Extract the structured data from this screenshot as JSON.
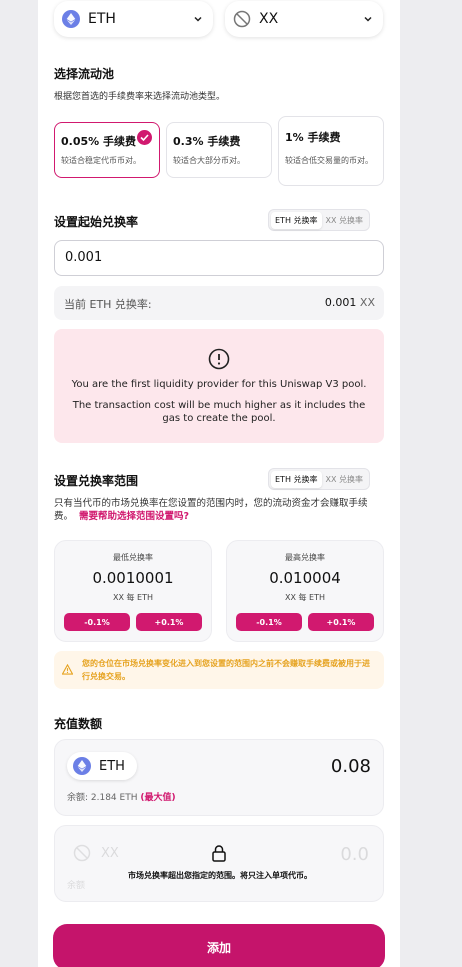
{
  "token_selectors": {
    "token_a": "ETH",
    "token_b": "XX"
  },
  "pool_section": {
    "title": "选择流动池",
    "subtitle": "根据您首选的手续费率来选择流动池类型。",
    "fees": [
      {
        "title": "0.05% 手续费",
        "desc": "较适合稳定代币币对。",
        "selected": true
      },
      {
        "title": "0.3% 手续费",
        "desc": "较适合大部分币对。",
        "selected": false
      },
      {
        "title": "1% 手续费",
        "desc": "较适合低交易量的币对。",
        "selected": false
      }
    ]
  },
  "start_price": {
    "title": "设置起始兑换率",
    "toggle": [
      "ETH 兑换率",
      "XX 兑换率"
    ],
    "input_value": "0.001",
    "current_label": "当前 ETH 兑换率:",
    "current_value": "0.001",
    "current_unit": "XX"
  },
  "warning": {
    "line1": "You are the first liquidity provider for this Uniswap V3 pool.",
    "line2": "The transaction cost will be much higher as it includes the gas to create the pool."
  },
  "range": {
    "title": "设置兑换率范围",
    "toggle": [
      "ETH 兑换率",
      "XX 兑换率"
    ],
    "desc": "只有当代币的市场兑换率在您设置的范围内时，您的流动资金才会赚取手续费。",
    "help_link": "需要帮助选择范围设置吗?",
    "min": {
      "label": "最低兑换率",
      "value": "0.0010001",
      "unit": "XX 每 ETH",
      "minus": "-0.1%",
      "plus": "+0.1%"
    },
    "max": {
      "label": "最高兑换率",
      "value": "0.010004",
      "unit": "XX 每 ETH",
      "minus": "-0.1%",
      "plus": "+0.1%"
    },
    "notice": "您的仓位在市场兑换率变化进入到您设置的范围内之前不会赚取手续费或被用于进行兑换交易。"
  },
  "deposit": {
    "title": "充值数额",
    "token_a": {
      "symbol": "ETH",
      "amount": "0.08",
      "balance": "余额: 2.184 ETH",
      "max": "(最大值)"
    },
    "token_b": {
      "symbol": "XX",
      "amount": "0.0",
      "balance_prefix": "余额",
      "locked_msg": "市场兑换率超出您指定的范围。将只注入单项代币。"
    }
  },
  "submit_label": "添加",
  "colors": {
    "accent": "#d1196f",
    "eth": "#6b7fe6",
    "warn_bg": "#fde7ec",
    "notice_text": "#e6a320"
  }
}
